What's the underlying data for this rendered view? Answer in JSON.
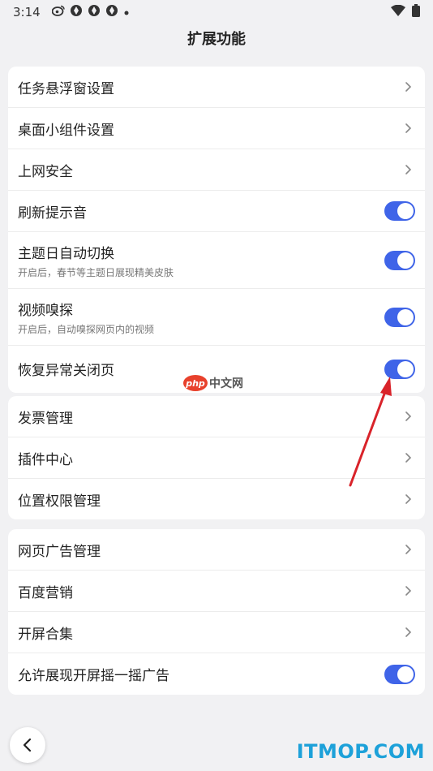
{
  "status_bar": {
    "time": "3:14",
    "icons": [
      "weibo-icon",
      "app-icon",
      "app-icon",
      "app-icon",
      "dot-icon"
    ],
    "right_icons": [
      "wifi-icon",
      "battery-icon"
    ]
  },
  "page": {
    "title": "扩展功能"
  },
  "card1": {
    "items": [
      {
        "label": "任务悬浮窗设置",
        "type": "link"
      },
      {
        "label": "桌面小组件设置",
        "type": "link"
      },
      {
        "label": "上网安全",
        "type": "link"
      },
      {
        "label": "刷新提示音",
        "type": "toggle",
        "on": true
      },
      {
        "label": "主题日自动切换",
        "sub": "开启后，春节等主题日展现精美皮肤",
        "type": "toggle",
        "on": true
      },
      {
        "label": "视频嗅探",
        "sub": "开启后，自动嗅探网页内的视频",
        "type": "toggle",
        "on": true
      },
      {
        "label": "恢复异常关闭页",
        "type": "toggle",
        "on": true
      }
    ]
  },
  "card2": {
    "items": [
      {
        "label": "发票管理",
        "type": "link"
      },
      {
        "label": "插件中心",
        "type": "link"
      },
      {
        "label": "位置权限管理",
        "type": "link"
      }
    ]
  },
  "card3": {
    "items": [
      {
        "label": "网页广告管理",
        "type": "link"
      },
      {
        "label": "百度营销",
        "type": "link"
      },
      {
        "label": "开屏合集",
        "type": "link"
      },
      {
        "label": "允许展现开屏摇一摇广告",
        "type": "toggle",
        "on": true
      }
    ]
  },
  "watermarks": {
    "php_logo": "php",
    "php_text": "中文网",
    "site": "ITMOP.COM"
  },
  "colors": {
    "toggle_on": "#3f64e8",
    "arrow": "#d9232a",
    "background": "#f1f1f3"
  }
}
